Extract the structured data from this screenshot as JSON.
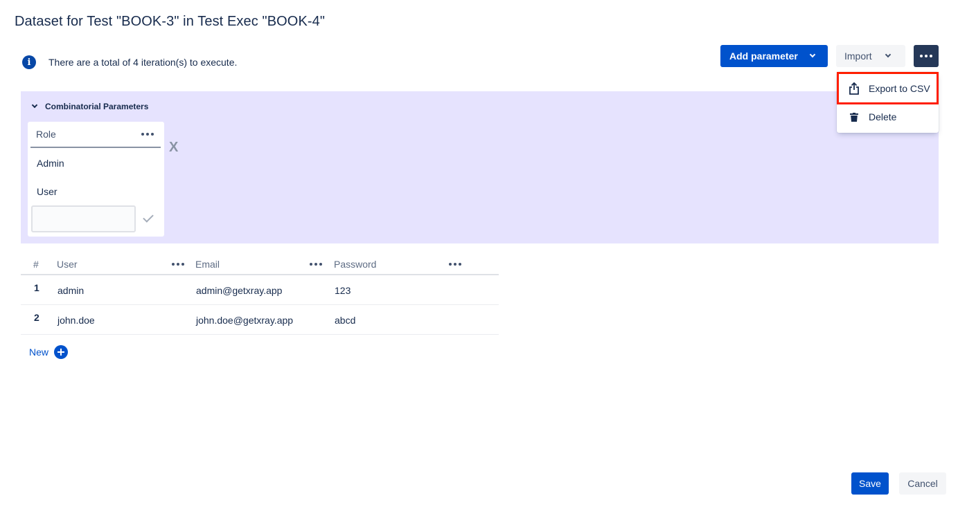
{
  "title": "Dataset for Test \"BOOK-3\" in Test Exec \"BOOK-4\"",
  "info": {
    "icon": "info-icon",
    "text": "There are a total of 4 iteration(s) to execute."
  },
  "toolbar": {
    "add_parameter_label": "Add parameter",
    "import_label": "Import",
    "more_icon": "ellipsis-icon"
  },
  "menu": {
    "items": [
      {
        "label": "Export to CSV",
        "icon": "export-icon"
      },
      {
        "label": "Delete",
        "icon": "trash-icon"
      }
    ],
    "highlight_color": "#ff1e00"
  },
  "combinatorial": {
    "title": "Combinatorial Parameters",
    "background": "#e6e3fe",
    "parameter": {
      "name": "Role",
      "values": [
        "Admin",
        "User"
      ],
      "new_value_placeholder": ""
    },
    "remove_label": "X"
  },
  "table": {
    "columns": [
      "#",
      "User",
      "Email",
      "Password"
    ],
    "rows": [
      {
        "num": "1",
        "user": "admin",
        "email": "admin@getxray.app",
        "password": "123"
      },
      {
        "num": "2",
        "user": "john.doe",
        "email": "john.doe@getxray.app",
        "password": "abcd"
      }
    ]
  },
  "new_label": "New",
  "footer": {
    "save_label": "Save",
    "cancel_label": "Cancel"
  },
  "colors": {
    "primary": "#0052cc",
    "dark": "#253858",
    "text": "#172b4d"
  }
}
